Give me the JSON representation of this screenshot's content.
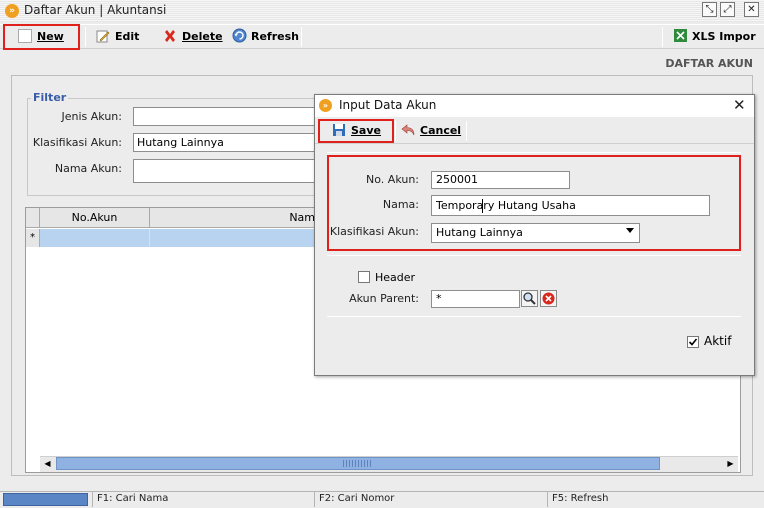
{
  "window": {
    "title": "Daftar Akun | Akuntansi",
    "logo_glyph": "»",
    "controls": [
      "⤡",
      "⤢",
      "✕"
    ]
  },
  "toolbar": {
    "new_label": "New",
    "edit_label": "Edit",
    "delete_label": "Delete",
    "refresh_label": "Refresh",
    "xls_label": "XLS Impor"
  },
  "page_heading": "DAFTAR AKUN",
  "filter": {
    "legend": "Filter",
    "jenis_label": "Jenis Akun:",
    "jenis_value": "",
    "klasifikasi_label": "Klasifikasi Akun:",
    "klasifikasi_value": "Hutang Lainnya",
    "nama_label": "Nama Akun:",
    "nama_value": ""
  },
  "grid": {
    "columns": [
      "No.Akun",
      "Nam"
    ],
    "new_row_marker": "*"
  },
  "statusbar": {
    "items": [
      "F1: Cari Nama",
      "F2: Cari Nomor",
      "F5: Refresh"
    ]
  },
  "dialog": {
    "title": "Input Data Akun",
    "close_glyph": "✕",
    "save_label": "Save",
    "cancel_label": "Cancel",
    "no_akun_label": "No. Akun:",
    "no_akun_value": "250001",
    "nama_label": "Nama:",
    "nama_value": "Temporary Hutang Usaha",
    "klasifikasi_label": "Klasifikasi Akun:",
    "klasifikasi_value": "Hutang Lainnya",
    "header_label": "Header",
    "header_checked": false,
    "parent_label": "Akun Parent:",
    "parent_value": "*",
    "aktif_label": "Aktif",
    "aktif_checked": true
  },
  "colors": {
    "highlight_red": "#e0201c",
    "selection_blue": "#b8d3f0",
    "accent_orange": "#f0a020"
  }
}
